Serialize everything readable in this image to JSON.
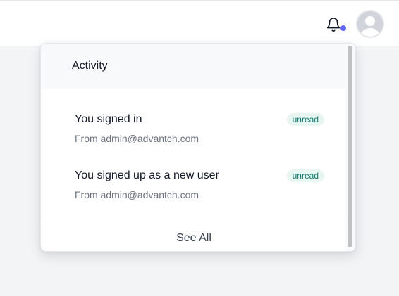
{
  "header": {
    "bell_icon": "bell-icon",
    "bell_indicator_color": "#6366f1",
    "avatar_icon": "user-avatar-icon"
  },
  "activity": {
    "title": "Activity",
    "notifications": [
      {
        "title": "You signed in",
        "subtitle": "From admin@advantch.com",
        "badge": "unread"
      },
      {
        "title": "You signed up as a new user",
        "subtitle": "From admin@advantch.com",
        "badge": "unread"
      }
    ],
    "see_all_label": "See All"
  },
  "colors": {
    "accent": "#6366f1",
    "badge_bg": "#e8f6f1",
    "badge_text": "#0f766e"
  }
}
